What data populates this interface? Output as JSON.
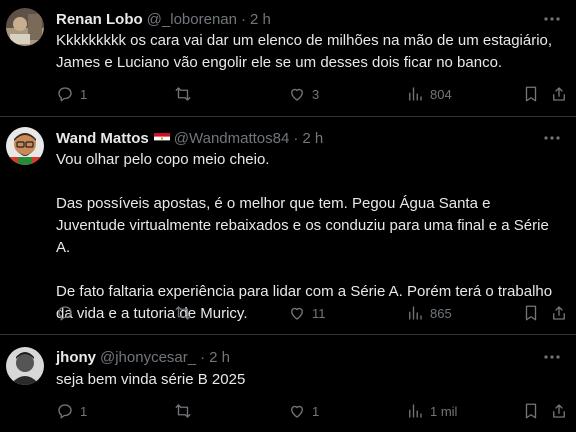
{
  "tweets": [
    {
      "name": "Renan Lobo",
      "handle": "@_loborenan",
      "time": "2 h",
      "text": "Kkkkkkkkk os cara vai dar um elenco de milhões na mão de um estagiário, James e Luciano vão engolir ele se um desses dois ficar no banco.",
      "replies": "1",
      "retweets": "",
      "likes": "3",
      "views": "804",
      "avatar_colors": [
        "#8a7a6a",
        "#c8b8a0"
      ]
    },
    {
      "name": "Wand Mattos",
      "handle": "@Wandmattos84",
      "time": "2 h",
      "text": "Vou olhar pelo copo meio cheio.\n\nDas possíveis apostas, é o melhor que tem. Pegou Água Santa e Juventude virtualmente rebaixados e os conduziu para uma final e a Série A.\n\nDe fato faltaria experiência para lidar com a Série A. Porém terá o trabalho da vida e a tutoria de Muricy.",
      "replies": "",
      "retweets": "",
      "likes": "11",
      "views": "865",
      "avatar_colors": [
        "#e0902a",
        "#2a6a3a"
      ]
    },
    {
      "name": "jhony",
      "handle": "@jhonycesar_",
      "time": "2 h",
      "text": "seja bem vinda série B 2025",
      "replies": "1",
      "retweets": "",
      "likes": "1",
      "views": "1 mil",
      "avatar_colors": [
        "#3a3a3a",
        "#9a9a9a"
      ]
    }
  ],
  "separator": "·",
  "colors": {
    "background": "#000000",
    "text": "#e7e9ea",
    "muted": "#71767b",
    "border": "#2f3336"
  }
}
